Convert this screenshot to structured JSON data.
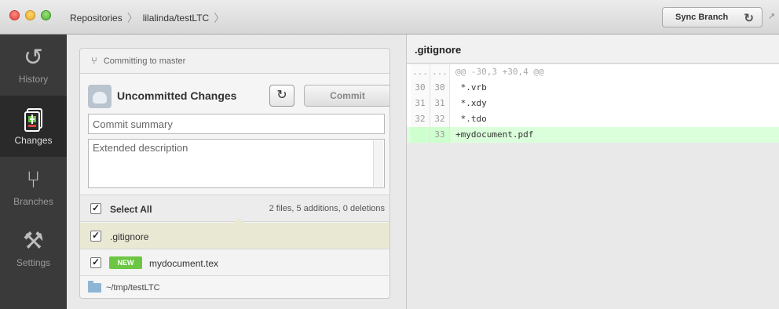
{
  "breadcrumb": {
    "root": "Repositories",
    "repo": "lilalinda/testLTC"
  },
  "toolbar": {
    "sync_label": "Sync Branch"
  },
  "sidebar": {
    "items": [
      {
        "label": "History",
        "icon": "history-icon"
      },
      {
        "label": "Changes",
        "icon": "changes-icon",
        "active": true
      },
      {
        "label": "Branches",
        "icon": "branches-icon"
      },
      {
        "label": "Settings",
        "icon": "settings-icon"
      }
    ]
  },
  "commit": {
    "branch_text": "Committing to master",
    "title": "Uncommitted Changes",
    "commit_label": "Commit",
    "summary_placeholder": "Commit summary",
    "summary_value": "",
    "description_placeholder": "Extended description",
    "description_value": "",
    "select_all_label": "Select All",
    "stats": "2 files, 5 additions, 0 deletions",
    "files": [
      {
        "name": ".gitignore",
        "checked": true,
        "selected": true,
        "badge": ""
      },
      {
        "name": "mydocument.tex",
        "checked": true,
        "selected": false,
        "badge": "NEW"
      }
    ],
    "path": "~/tmp/testLTC"
  },
  "diff": {
    "filename": ".gitignore",
    "lines": [
      {
        "old": "...",
        "new": "...",
        "text": "@@ -30,3 +30,4 @@",
        "kind": "hunk"
      },
      {
        "old": "30",
        "new": "30",
        "text": " *.vrb",
        "kind": "context"
      },
      {
        "old": "31",
        "new": "31",
        "text": " *.xdy",
        "kind": "context"
      },
      {
        "old": "32",
        "new": "32",
        "text": " *.tdo",
        "kind": "context"
      },
      {
        "old": "",
        "new": "33",
        "text": "+mydocument.pdf",
        "kind": "add"
      }
    ]
  },
  "colors": {
    "added_bg": "#dbffdb",
    "new_badge": "#6cc644",
    "sidebar_bg": "#3a3a3a",
    "selected_row": "#e9e8d3"
  }
}
